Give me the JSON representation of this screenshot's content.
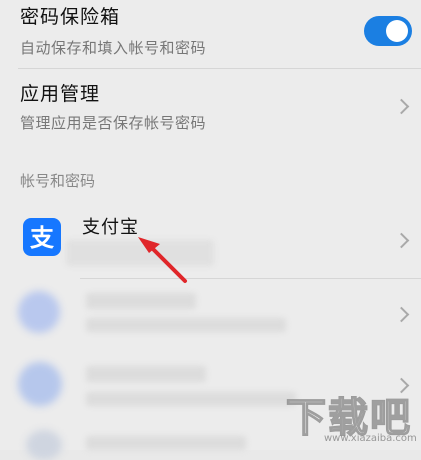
{
  "settings": {
    "password_vault": {
      "title": "密码保险箱",
      "subtitle": "自动保存和填入帐号和密码",
      "toggle_on": true
    },
    "app_management": {
      "title": "应用管理",
      "subtitle": "管理应用是否保存帐号密码"
    }
  },
  "accounts_section": {
    "header": "帐号和密码",
    "items": [
      {
        "name": "支付宝",
        "icon": "alipay-icon"
      },
      {
        "name": "",
        "icon": "blurred-app-icon"
      },
      {
        "name": "",
        "icon": "blurred-app-icon"
      }
    ]
  },
  "colors": {
    "toggle_accent": "#1b7fe2",
    "alipay_blue": "#1677ff",
    "annotation_arrow": "#e0262a"
  },
  "watermark": {
    "big": "下载吧",
    "small": "www.xiazaiba.com"
  }
}
